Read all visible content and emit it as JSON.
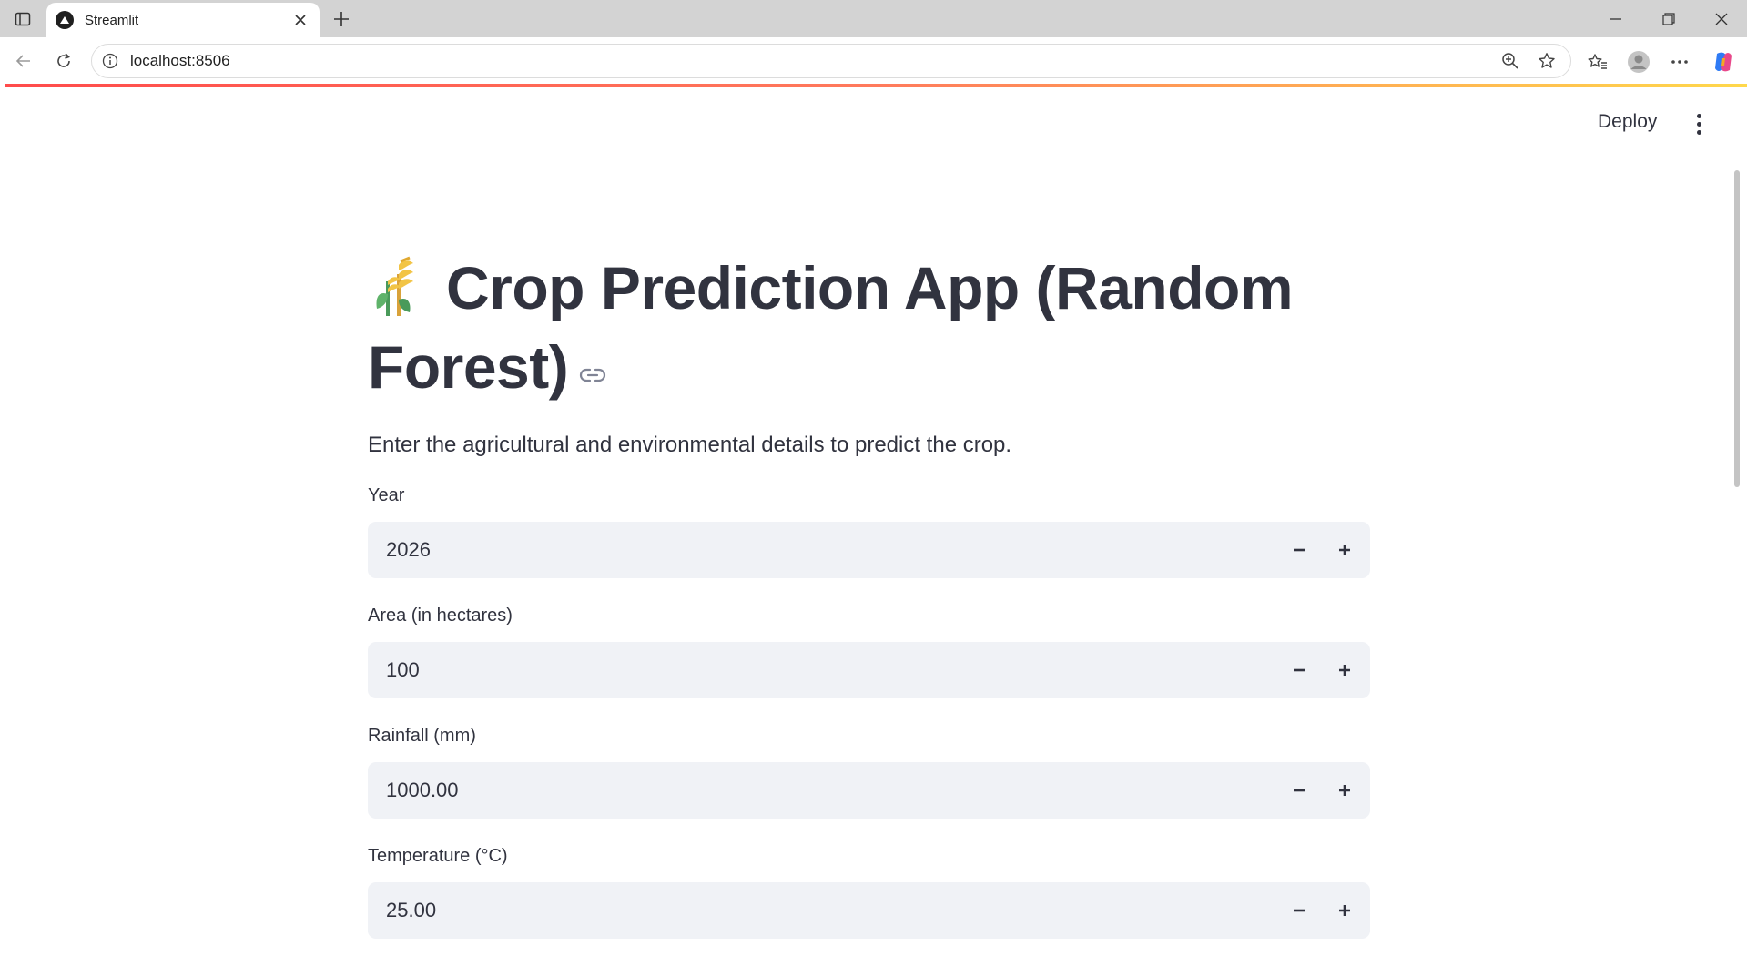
{
  "browser": {
    "tab_title": "Streamlit",
    "url": "localhost:8506"
  },
  "header": {
    "deploy_label": "Deploy"
  },
  "main": {
    "title": "Crop Prediction App (Random Forest)",
    "subtitle": "Enter the agricultural and environmental details to predict the crop.",
    "fields": [
      {
        "label": "Year",
        "value": "2026"
      },
      {
        "label": "Area (in hectares)",
        "value": "100"
      },
      {
        "label": "Rainfall (mm)",
        "value": "1000.00"
      },
      {
        "label": "Temperature (°C)",
        "value": "25.00"
      }
    ]
  },
  "icons": {
    "title_emoji": "sheaf-of-rice-icon",
    "decrement": "minus-icon",
    "increment": "plus-icon"
  },
  "colors": {
    "text": "#31333f",
    "input_bg": "#f0f2f6",
    "accent_start": "#ff4b4b",
    "accent_end": "#ffd84b"
  }
}
